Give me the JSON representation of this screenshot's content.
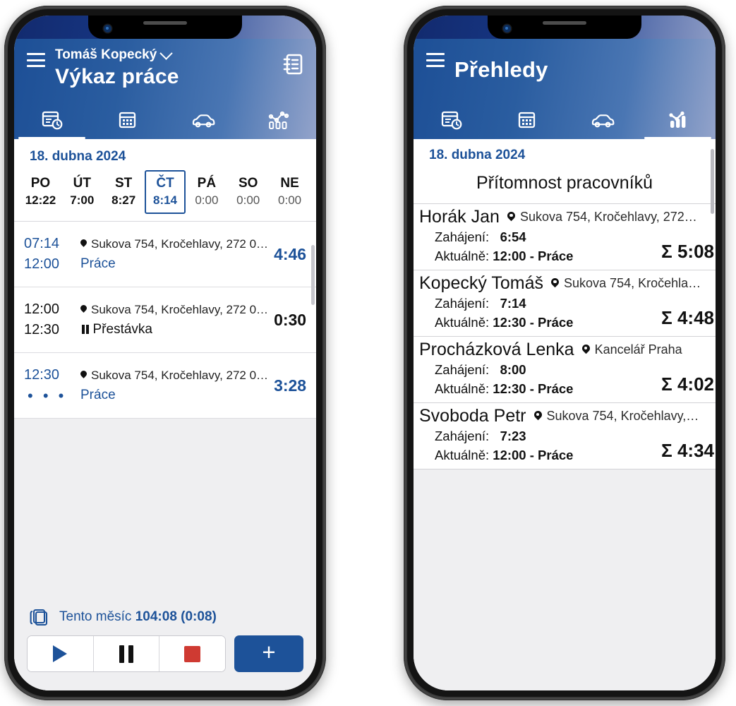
{
  "phones": [
    {
      "id": "timesheet",
      "appbar": {
        "user_name": "Tomáš Kopecký",
        "title": "Výkaz práce",
        "menu_icon": "hamburger-menu-icon",
        "action_icon": "notebook-icon",
        "chevron_icon": "chevron-down-icon"
      },
      "tabs": [
        {
          "icon": "timesheet-clock-icon",
          "active": true
        },
        {
          "icon": "calendar-icon",
          "active": false
        },
        {
          "icon": "car-icon",
          "active": false
        },
        {
          "icon": "chart-outline-icon",
          "active": false
        }
      ],
      "date": "18. dubna 2024",
      "weekdays": [
        {
          "day": "PO",
          "hours": "12:22",
          "selected": false,
          "zero": false
        },
        {
          "day": "ÚT",
          "hours": "7:00",
          "selected": false,
          "zero": false
        },
        {
          "day": "ST",
          "hours": "8:27",
          "selected": false,
          "zero": false
        },
        {
          "day": "ČT",
          "hours": "8:14",
          "selected": true,
          "zero": false
        },
        {
          "day": "PÁ",
          "hours": "0:00",
          "selected": false,
          "zero": true
        },
        {
          "day": "SO",
          "hours": "0:00",
          "selected": false,
          "zero": true
        },
        {
          "day": "NE",
          "hours": "0:00",
          "selected": false,
          "zero": true
        }
      ],
      "entries": [
        {
          "start": "07:14",
          "end": "12:00",
          "address": "Sukova 754, Kročehlavy, 272 0…",
          "kind": "Práce",
          "kind_icon": "work-icon",
          "duration": "4:46",
          "accent": true,
          "ongoing": false
        },
        {
          "start": "12:00",
          "end": "12:30",
          "address": "Sukova 754, Kročehlavy, 272 0…",
          "kind": "Přestávka",
          "kind_icon": "pause-icon",
          "duration": "0:30",
          "accent": false,
          "ongoing": false
        },
        {
          "start": "12:30",
          "end": "• • •",
          "address": "Sukova 754, Kročehlavy, 272 0…",
          "kind": "Práce",
          "kind_icon": "work-icon",
          "duration": "3:28",
          "accent": true,
          "ongoing": true
        }
      ],
      "summary": {
        "icon": "layers-icon",
        "label": "Tento měsíc",
        "value": "104:08 (0:08)"
      },
      "controls": [
        {
          "name": "play-button",
          "icon": "play-icon"
        },
        {
          "name": "pause-button",
          "icon": "pause-icon"
        },
        {
          "name": "stop-button",
          "icon": "stop-icon"
        }
      ],
      "fab": {
        "label": "+",
        "name": "add-button"
      }
    },
    {
      "id": "overview",
      "appbar": {
        "title": "Přehledy",
        "menu_icon": "hamburger-menu-icon"
      },
      "tabs": [
        {
          "icon": "timesheet-clock-icon",
          "active": false
        },
        {
          "icon": "calendar-icon",
          "active": false
        },
        {
          "icon": "car-icon",
          "active": false
        },
        {
          "icon": "chart-solid-icon",
          "active": true
        }
      ],
      "date": "18. dubna 2024",
      "section_title": "Přítomnost pracovníků",
      "employees": [
        {
          "name": "Horák Jan",
          "location": "Sukova 754, Kročehlavy, 272…",
          "start_label": "Zahájení:",
          "start_value": "6:54",
          "current_label": "Aktuálně:",
          "current_time": "12:00",
          "current_kind": "- Práce",
          "total": "Σ 5:08"
        },
        {
          "name": "Kopecký Tomáš",
          "location": "Sukova 754, Kročehla…",
          "start_label": "Zahájení:",
          "start_value": "7:14",
          "current_label": "Aktuálně:",
          "current_time": "12:30",
          "current_kind": "- Práce",
          "total": "Σ 4:48"
        },
        {
          "name": "Procházková Lenka",
          "location": "Kancelář Praha",
          "start_label": "Zahájení:",
          "start_value": "8:00",
          "current_label": "Aktuálně:",
          "current_time": "12:30",
          "current_kind": "- Práce",
          "total": "Σ 4:02"
        },
        {
          "name": "Svoboda Petr",
          "location": "Sukova 754, Kročehlavy,…",
          "start_label": "Zahájení:",
          "start_value": "7:23",
          "current_label": "Aktuálně:",
          "current_time": "12:00",
          "current_kind": "- Práce",
          "total": "Σ 4:34"
        }
      ]
    }
  ],
  "colors": {
    "brand_blue": "#1d5299",
    "header_dark": "#122a6e",
    "header_light": "#93a3ca",
    "stop_red": "#cf3a32",
    "page_bg": "#efeff1"
  }
}
